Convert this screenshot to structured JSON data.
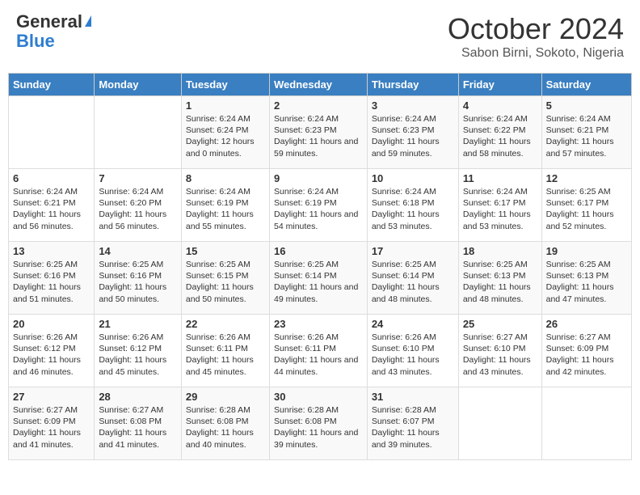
{
  "header": {
    "logo_general": "General",
    "logo_blue": "Blue",
    "month": "October 2024",
    "location": "Sabon Birni, Sokoto, Nigeria"
  },
  "days_of_week": [
    "Sunday",
    "Monday",
    "Tuesday",
    "Wednesday",
    "Thursday",
    "Friday",
    "Saturday"
  ],
  "weeks": [
    [
      {
        "day": "",
        "info": ""
      },
      {
        "day": "",
        "info": ""
      },
      {
        "day": "1",
        "info": "Sunrise: 6:24 AM\nSunset: 6:24 PM\nDaylight: 12 hours and 0 minutes."
      },
      {
        "day": "2",
        "info": "Sunrise: 6:24 AM\nSunset: 6:23 PM\nDaylight: 11 hours and 59 minutes."
      },
      {
        "day": "3",
        "info": "Sunrise: 6:24 AM\nSunset: 6:23 PM\nDaylight: 11 hours and 59 minutes."
      },
      {
        "day": "4",
        "info": "Sunrise: 6:24 AM\nSunset: 6:22 PM\nDaylight: 11 hours and 58 minutes."
      },
      {
        "day": "5",
        "info": "Sunrise: 6:24 AM\nSunset: 6:21 PM\nDaylight: 11 hours and 57 minutes."
      }
    ],
    [
      {
        "day": "6",
        "info": "Sunrise: 6:24 AM\nSunset: 6:21 PM\nDaylight: 11 hours and 56 minutes."
      },
      {
        "day": "7",
        "info": "Sunrise: 6:24 AM\nSunset: 6:20 PM\nDaylight: 11 hours and 56 minutes."
      },
      {
        "day": "8",
        "info": "Sunrise: 6:24 AM\nSunset: 6:19 PM\nDaylight: 11 hours and 55 minutes."
      },
      {
        "day": "9",
        "info": "Sunrise: 6:24 AM\nSunset: 6:19 PM\nDaylight: 11 hours and 54 minutes."
      },
      {
        "day": "10",
        "info": "Sunrise: 6:24 AM\nSunset: 6:18 PM\nDaylight: 11 hours and 53 minutes."
      },
      {
        "day": "11",
        "info": "Sunrise: 6:24 AM\nSunset: 6:17 PM\nDaylight: 11 hours and 53 minutes."
      },
      {
        "day": "12",
        "info": "Sunrise: 6:25 AM\nSunset: 6:17 PM\nDaylight: 11 hours and 52 minutes."
      }
    ],
    [
      {
        "day": "13",
        "info": "Sunrise: 6:25 AM\nSunset: 6:16 PM\nDaylight: 11 hours and 51 minutes."
      },
      {
        "day": "14",
        "info": "Sunrise: 6:25 AM\nSunset: 6:16 PM\nDaylight: 11 hours and 50 minutes."
      },
      {
        "day": "15",
        "info": "Sunrise: 6:25 AM\nSunset: 6:15 PM\nDaylight: 11 hours and 50 minutes."
      },
      {
        "day": "16",
        "info": "Sunrise: 6:25 AM\nSunset: 6:14 PM\nDaylight: 11 hours and 49 minutes."
      },
      {
        "day": "17",
        "info": "Sunrise: 6:25 AM\nSunset: 6:14 PM\nDaylight: 11 hours and 48 minutes."
      },
      {
        "day": "18",
        "info": "Sunrise: 6:25 AM\nSunset: 6:13 PM\nDaylight: 11 hours and 48 minutes."
      },
      {
        "day": "19",
        "info": "Sunrise: 6:25 AM\nSunset: 6:13 PM\nDaylight: 11 hours and 47 minutes."
      }
    ],
    [
      {
        "day": "20",
        "info": "Sunrise: 6:26 AM\nSunset: 6:12 PM\nDaylight: 11 hours and 46 minutes."
      },
      {
        "day": "21",
        "info": "Sunrise: 6:26 AM\nSunset: 6:12 PM\nDaylight: 11 hours and 45 minutes."
      },
      {
        "day": "22",
        "info": "Sunrise: 6:26 AM\nSunset: 6:11 PM\nDaylight: 11 hours and 45 minutes."
      },
      {
        "day": "23",
        "info": "Sunrise: 6:26 AM\nSunset: 6:11 PM\nDaylight: 11 hours and 44 minutes."
      },
      {
        "day": "24",
        "info": "Sunrise: 6:26 AM\nSunset: 6:10 PM\nDaylight: 11 hours and 43 minutes."
      },
      {
        "day": "25",
        "info": "Sunrise: 6:27 AM\nSunset: 6:10 PM\nDaylight: 11 hours and 43 minutes."
      },
      {
        "day": "26",
        "info": "Sunrise: 6:27 AM\nSunset: 6:09 PM\nDaylight: 11 hours and 42 minutes."
      }
    ],
    [
      {
        "day": "27",
        "info": "Sunrise: 6:27 AM\nSunset: 6:09 PM\nDaylight: 11 hours and 41 minutes."
      },
      {
        "day": "28",
        "info": "Sunrise: 6:27 AM\nSunset: 6:08 PM\nDaylight: 11 hours and 41 minutes."
      },
      {
        "day": "29",
        "info": "Sunrise: 6:28 AM\nSunset: 6:08 PM\nDaylight: 11 hours and 40 minutes."
      },
      {
        "day": "30",
        "info": "Sunrise: 6:28 AM\nSunset: 6:08 PM\nDaylight: 11 hours and 39 minutes."
      },
      {
        "day": "31",
        "info": "Sunrise: 6:28 AM\nSunset: 6:07 PM\nDaylight: 11 hours and 39 minutes."
      },
      {
        "day": "",
        "info": ""
      },
      {
        "day": "",
        "info": ""
      }
    ]
  ]
}
